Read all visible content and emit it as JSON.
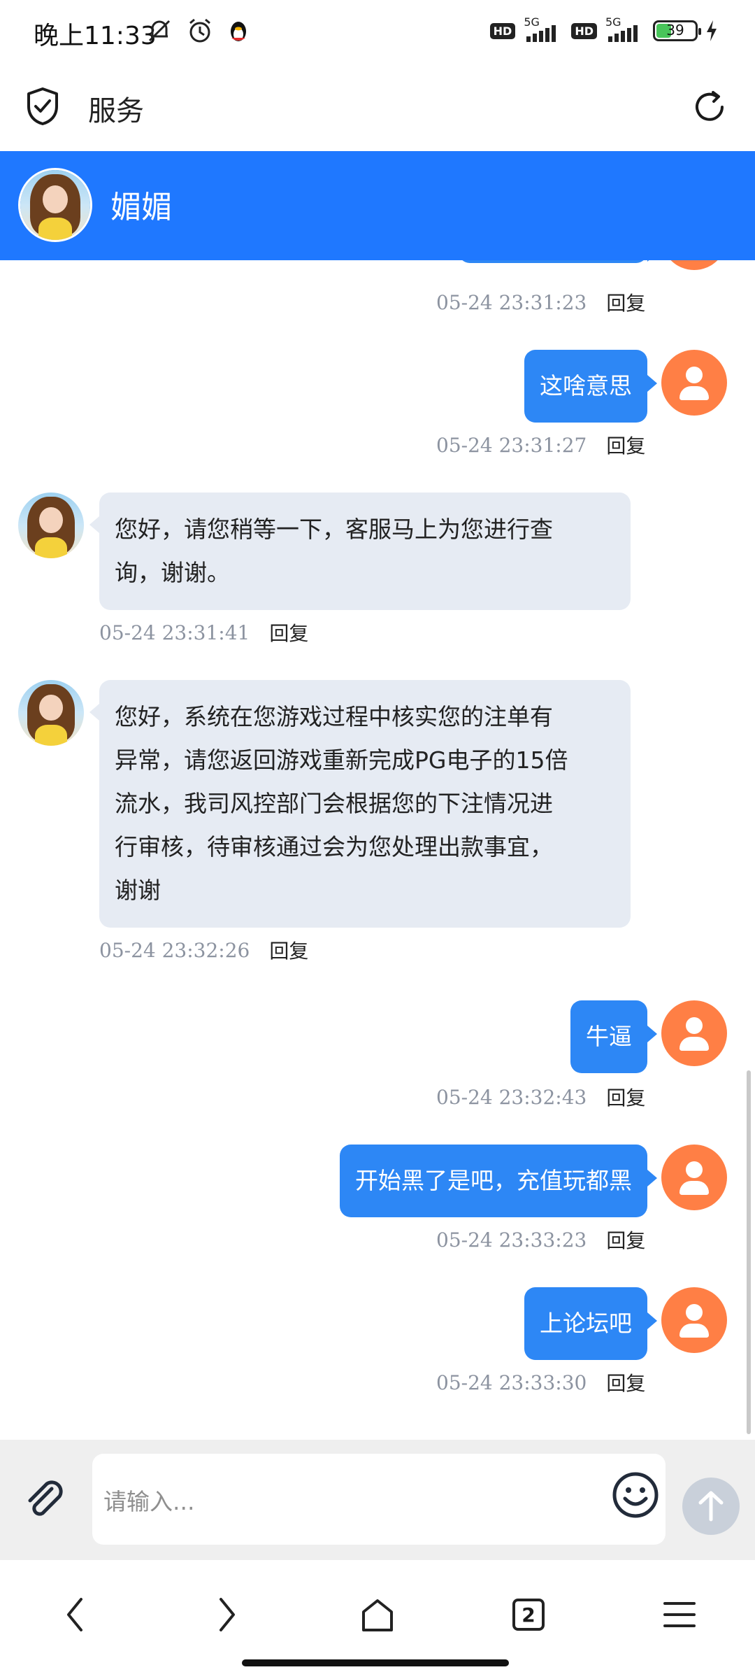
{
  "status_bar": {
    "time": "晚上11:33",
    "hd_label": "HD",
    "network_label": "5G",
    "battery_level": "39",
    "battery_fraction": 0.39
  },
  "app_header": {
    "title": "服务",
    "icons": [
      "shield-check-icon",
      "refresh-icon"
    ]
  },
  "chat_header": {
    "contact_name": "媚媚"
  },
  "messages": [
    {
      "sender": "me",
      "text": "",
      "time": "05-24 23:31:23",
      "reply": "回复"
    },
    {
      "sender": "me",
      "text": "这啥意思",
      "time": "05-24 23:31:27",
      "reply": "回复"
    },
    {
      "sender": "them",
      "lines": [
        "您好，请您稍等一下，客服马上为您进行查",
        "询，谢谢。"
      ],
      "time": "05-24 23:31:41",
      "reply": "回复"
    },
    {
      "sender": "them",
      "lines": [
        "您好，系统在您游戏过程中核实您的注单有",
        "异常，请您返回游戏重新完成PG电子的15倍",
        "流水，我司风控部门会根据您的下注情况进",
        "行审核，待审核通过会为您处理出款事宜，",
        "谢谢"
      ],
      "time": "05-24 23:32:26",
      "reply": "回复"
    },
    {
      "sender": "me",
      "text": "牛逼",
      "time": "05-24 23:32:43",
      "reply": "回复"
    },
    {
      "sender": "me",
      "text": "开始黑了是吧，充值玩都黑",
      "time": "05-24 23:33:23",
      "reply": "回复"
    },
    {
      "sender": "me",
      "text": "上论坛吧",
      "time": "05-24 23:33:30",
      "reply": "回复"
    }
  ],
  "input": {
    "placeholder": "请输入..."
  },
  "browser_nav": {
    "tab_count": "2"
  },
  "colors": {
    "chat_header_bg": "#1f78ff",
    "my_bubble": "#2d87f5",
    "their_bubble": "#e6ebf3",
    "user_avatar": "#ff7f45"
  }
}
